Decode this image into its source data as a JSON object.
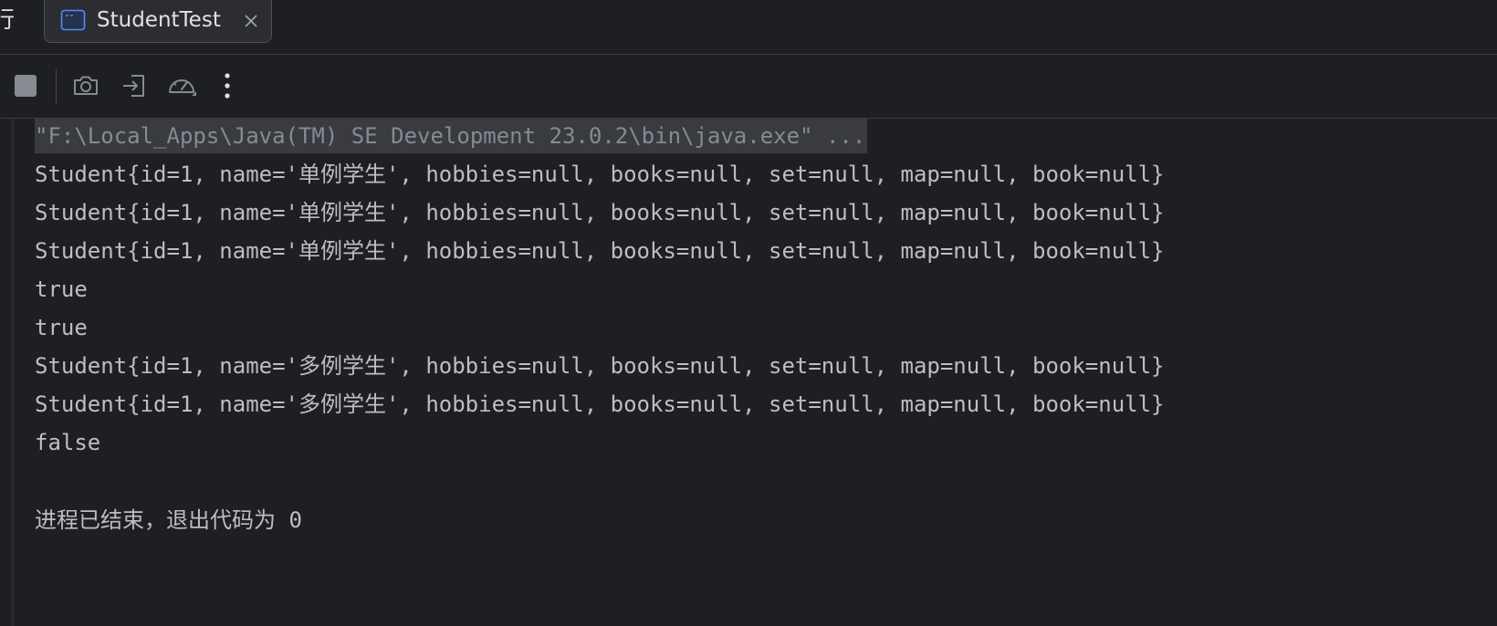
{
  "tabbar": {
    "run_glyph": "行",
    "tab": {
      "label": "StudentTest",
      "icon": "console-icon",
      "close_icon": "close-icon"
    }
  },
  "toolbar": {
    "buttons": [
      {
        "name": "stop-button",
        "icon": "stop-icon"
      },
      {
        "name": "screenshot-button",
        "icon": "camera-icon"
      },
      {
        "name": "exit-button",
        "icon": "exit-icon"
      },
      {
        "name": "profiler-button",
        "icon": "speedometer-icon"
      },
      {
        "name": "more-button",
        "icon": "more-vertical-icon"
      }
    ]
  },
  "console": {
    "command": "\"F:\\Local_Apps\\Java(TM) SE Development 23.0.2\\bin\\java.exe\" ...",
    "output": [
      "Student{id=1, name='单例学生', hobbies=null, books=null, set=null, map=null, book=null}",
      "Student{id=1, name='单例学生', hobbies=null, books=null, set=null, map=null, book=null}",
      "Student{id=1, name='单例学生', hobbies=null, books=null, set=null, map=null, book=null}",
      "true",
      "true",
      "Student{id=1, name='多例学生', hobbies=null, books=null, set=null, map=null, book=null}",
      "Student{id=1, name='多例学生', hobbies=null, books=null, set=null, map=null, book=null}",
      "false"
    ],
    "exit_message": "进程已结束，退出代码为 0"
  },
  "colors": {
    "background": "#1e1f22",
    "text": "#bcbec4",
    "command_text": "#868a91",
    "command_highlight": "#393b40"
  }
}
